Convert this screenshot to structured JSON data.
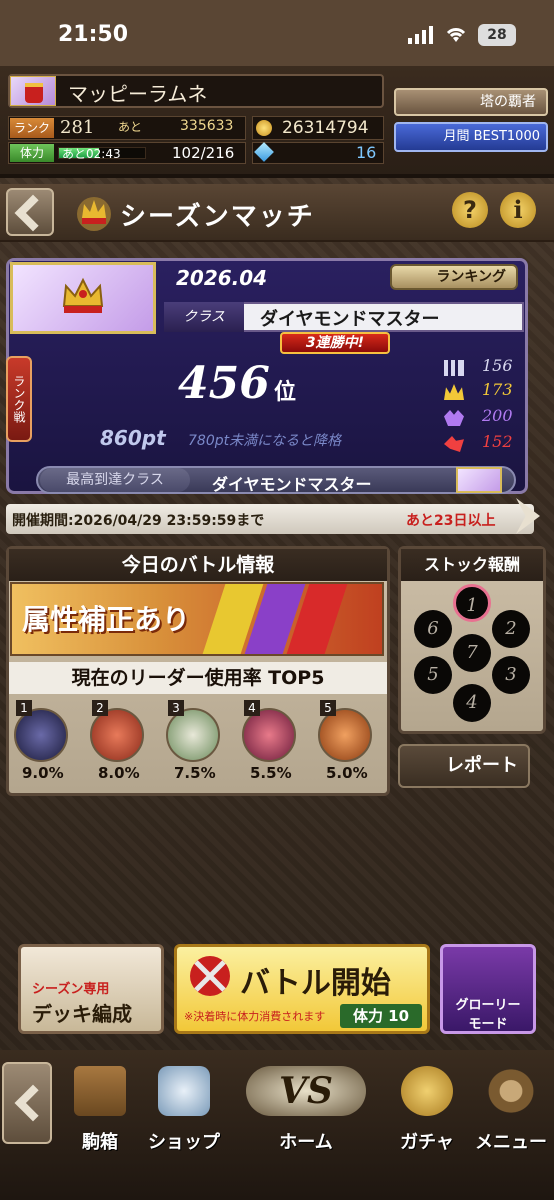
{
  "status": {
    "time": "21:50",
    "battery": "28"
  },
  "player": {
    "name": "マッピーラムネ",
    "rank_label": "ランク",
    "rank": "281",
    "rank_next_label": "あと",
    "rank_next": "335633",
    "stamina_label": "体力",
    "stamina_timer": "あと02:43",
    "stamina": "102/216",
    "stamina_fraction": 0.47,
    "gold": "26314794",
    "gems": "16"
  },
  "side_buttons": {
    "tower": "塔の覇者",
    "monthly": "月間 BEST1000"
  },
  "header": {
    "title": "シーズンマッチ",
    "help": "?",
    "info": "i"
  },
  "season": {
    "period": "2026.04",
    "ranking_btn": "ランキング",
    "class_label": "クラス",
    "class_value": "ダイヤモンドマスター",
    "streak": "3連勝中!",
    "side_tab": "ランク戦",
    "rank_position": "456",
    "rank_unit": "位",
    "points": "860pt",
    "points_note": "780pt未満になると降格",
    "stats": [
      {
        "icon": "bars-icon",
        "value": "156",
        "color": "#d8d8f0"
      },
      {
        "icon": "crown-icon",
        "value": "173",
        "color": "#f2c838"
      },
      {
        "icon": "demon-icon",
        "value": "200",
        "color": "#b07af0"
      },
      {
        "icon": "dragon-icon",
        "value": "152",
        "color": "#f04040"
      }
    ],
    "highest_label": "最高到達クラス",
    "highest_value": "ダイヤモンドマスター",
    "schedule": "開催期間:2026/04/29 23:59:59まで",
    "remaining": "あと23日以上"
  },
  "battle_info": {
    "title": "今日のバトル情報",
    "attribute": "属性補正あり",
    "leaders_title": "現在のリーダー使用率 TOP5",
    "leaders": [
      {
        "num": "1",
        "pct": "9.0%"
      },
      {
        "num": "2",
        "pct": "8.0%"
      },
      {
        "num": "3",
        "pct": "7.5%"
      },
      {
        "num": "4",
        "pct": "5.5%"
      },
      {
        "num": "5",
        "pct": "5.0%"
      }
    ]
  },
  "stock": {
    "title": "ストック報酬",
    "nodes": [
      "1",
      "2",
      "3",
      "4",
      "5",
      "6",
      "7"
    ],
    "report_btn": "レポート"
  },
  "actions": {
    "deck_small": "シーズン専用",
    "deck": "デッキ編成",
    "battle": "バトル開始",
    "battle_note": "※決着時に体力消費されます",
    "battle_cost": "体力 10",
    "glory": "グローリーモード"
  },
  "nav": {
    "items": [
      "駒箱",
      "ショップ",
      "ホーム",
      "ガチャ",
      "メニュー"
    ]
  }
}
